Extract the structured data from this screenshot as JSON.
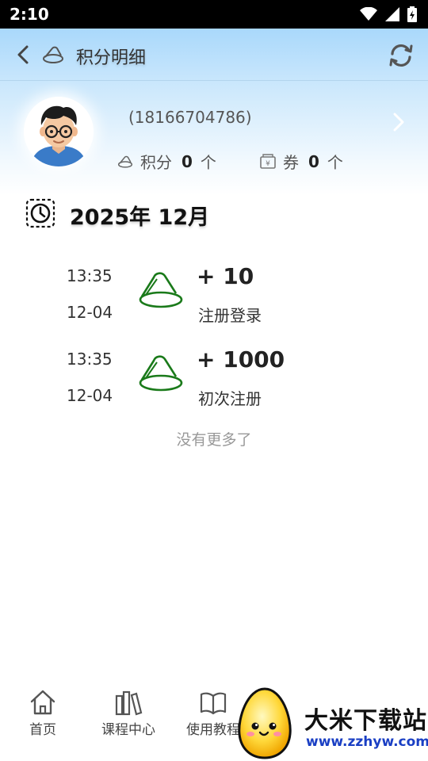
{
  "status_bar": {
    "time": "2:10"
  },
  "header": {
    "title": "积分明细"
  },
  "profile": {
    "phone": "(18166704786)",
    "points_label": "积分",
    "points_value": "0",
    "points_unit": "个",
    "coupon_label": "券",
    "coupon_value": "0",
    "coupon_unit": "个"
  },
  "month": {
    "title": "2025年 12月"
  },
  "records": [
    {
      "time": "13:35",
      "date": "12-04",
      "amount": "+ 10",
      "description": "注册登录"
    },
    {
      "time": "13:35",
      "date": "12-04",
      "amount": "+ 1000",
      "description": "初次注册"
    }
  ],
  "list_end_text": "没有更多了",
  "bottom_nav": [
    {
      "label": "首页",
      "icon": "home-icon"
    },
    {
      "label": "课程中心",
      "icon": "books-icon"
    },
    {
      "label": "使用教程",
      "icon": "open-book-icon"
    }
  ],
  "watermark": {
    "title": "大米下载站",
    "url": "www.zzhyw.com"
  },
  "colors": {
    "coin_green": "#1a7a1a",
    "header_blue": "#a9d8fb",
    "muted_text": "#999999"
  }
}
